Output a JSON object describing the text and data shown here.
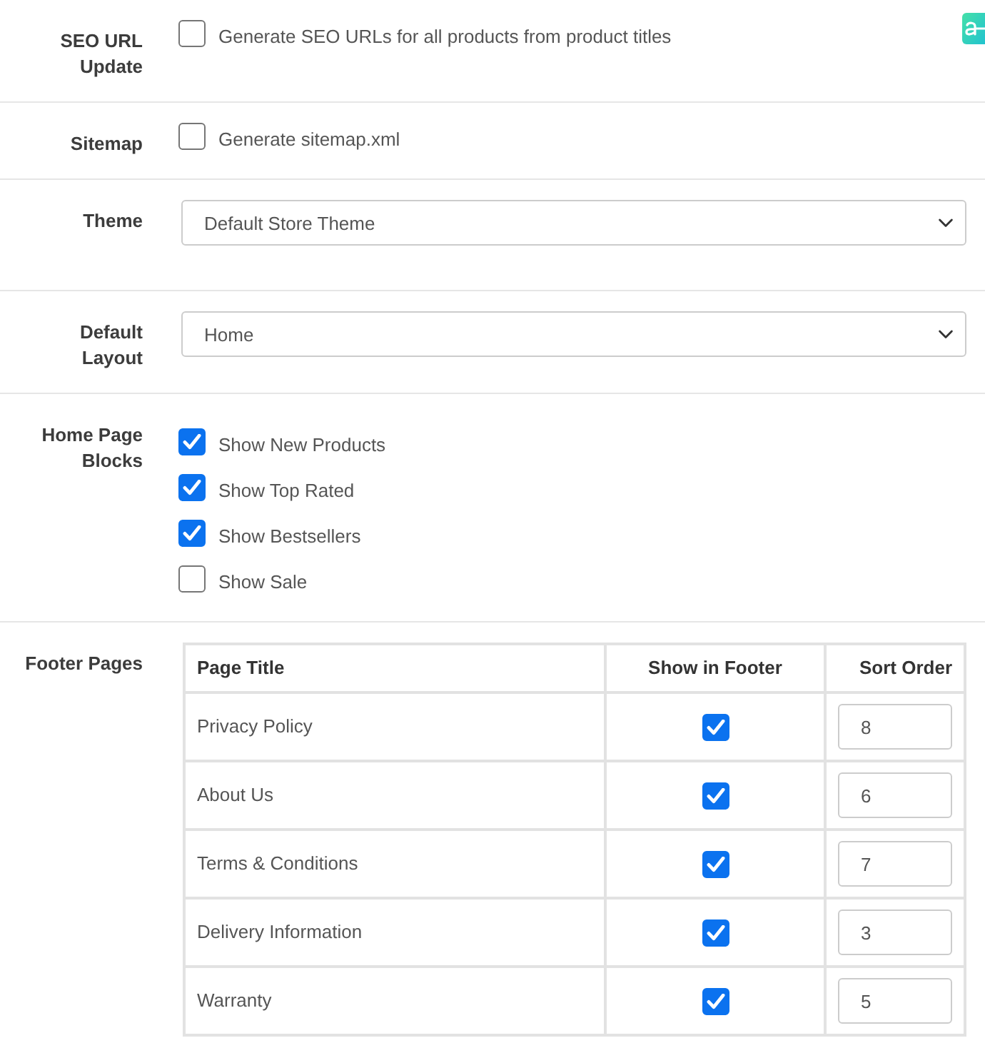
{
  "settings": [
    {
      "kind": "checkboxes",
      "label": "SEO URL Update",
      "options": [
        {
          "text": "Generate SEO URLs for all products from product titles",
          "checked": false
        }
      ]
    },
    {
      "kind": "checkboxes",
      "label": "Sitemap",
      "options": [
        {
          "text": "Generate sitemap.xml",
          "checked": false
        }
      ]
    },
    {
      "kind": "select",
      "label": "Theme",
      "value": "Default Store Theme"
    },
    {
      "kind": "select",
      "label": "Default Layout",
      "value": "Home"
    },
    {
      "kind": "checkboxes",
      "label": "Home Page Blocks",
      "options": [
        {
          "text": "Show New Products",
          "checked": true
        },
        {
          "text": "Show Top Rated",
          "checked": true
        },
        {
          "text": "Show Bestsellers",
          "checked": true
        },
        {
          "text": "Show Sale",
          "checked": false
        }
      ]
    },
    {
      "kind": "table",
      "label": "Footer Pages",
      "columns": [
        "Page Title",
        "Show in Footer",
        "Sort Order"
      ],
      "rows": [
        {
          "title": "Privacy Policy",
          "show_in_footer": true,
          "sort_order": "8"
        },
        {
          "title": "About Us",
          "show_in_footer": true,
          "sort_order": "6"
        },
        {
          "title": "Terms & Conditions",
          "show_in_footer": true,
          "sort_order": "7"
        },
        {
          "title": "Delivery Information",
          "show_in_footer": true,
          "sort_order": "3"
        },
        {
          "title": "Warranty",
          "show_in_footer": true,
          "sort_order": "5"
        }
      ]
    }
  ]
}
